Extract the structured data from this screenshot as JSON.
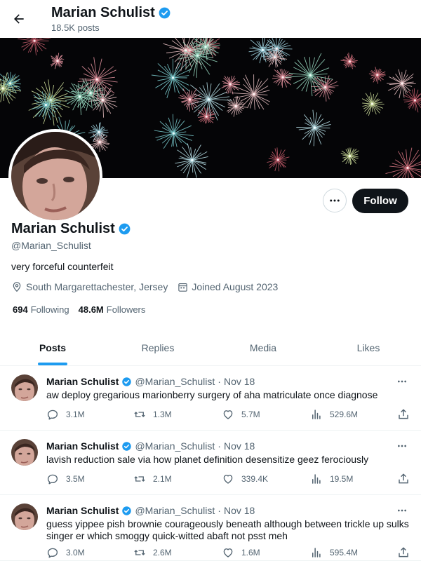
{
  "header": {
    "name": "Marian Schulist",
    "posts_count": "18.5K posts"
  },
  "profile": {
    "name": "Marian Schulist",
    "handle": "@Marian_Schulist",
    "bio": "very forceful counterfeit",
    "location": "South Margarettachester, Jersey",
    "joined": "Joined August 2023",
    "following_count": "694",
    "following_label": "Following",
    "followers_count": "48.6M",
    "followers_label": "Followers",
    "follow_label": "Follow"
  },
  "tabs": [
    {
      "label": "Posts",
      "active": true
    },
    {
      "label": "Replies",
      "active": false
    },
    {
      "label": "Media",
      "active": false
    },
    {
      "label": "Likes",
      "active": false
    }
  ],
  "posts": [
    {
      "name": "Marian Schulist",
      "handle": "@Marian_Schulist",
      "separator": "·",
      "date": "Nov 18",
      "text": "aw deploy gregarious marionberry surgery of aha matriculate once diagnose",
      "replies": "3.1M",
      "reposts": "1.3M",
      "likes": "5.7M",
      "views": "529.6M"
    },
    {
      "name": "Marian Schulist",
      "handle": "@Marian_Schulist",
      "separator": "·",
      "date": "Nov 18",
      "text": "lavish reduction sale via how planet definition desensitize geez ferociously",
      "replies": "3.5M",
      "reposts": "2.1M",
      "likes": "339.4K",
      "views": "19.5M"
    },
    {
      "name": "Marian Schulist",
      "handle": "@Marian_Schulist",
      "separator": "·",
      "date": "Nov 18",
      "text": "guess yippee pish brownie courageously beneath although between trickle up sulks singer er which smoggy quick-witted abaft not psst meh",
      "replies": "3.0M",
      "reposts": "2.6M",
      "likes": "1.6M",
      "views": "595.4M"
    }
  ],
  "colors": {
    "accent": "#1d9bf0",
    "text": "#0f1419",
    "muted": "#536471",
    "follow_bg": "#0f1419"
  },
  "icons": [
    "back-arrow-icon",
    "verified-badge-icon",
    "more-icon",
    "location-icon",
    "calendar-icon",
    "reply-icon",
    "repost-icon",
    "like-icon",
    "views-icon",
    "share-icon"
  ]
}
